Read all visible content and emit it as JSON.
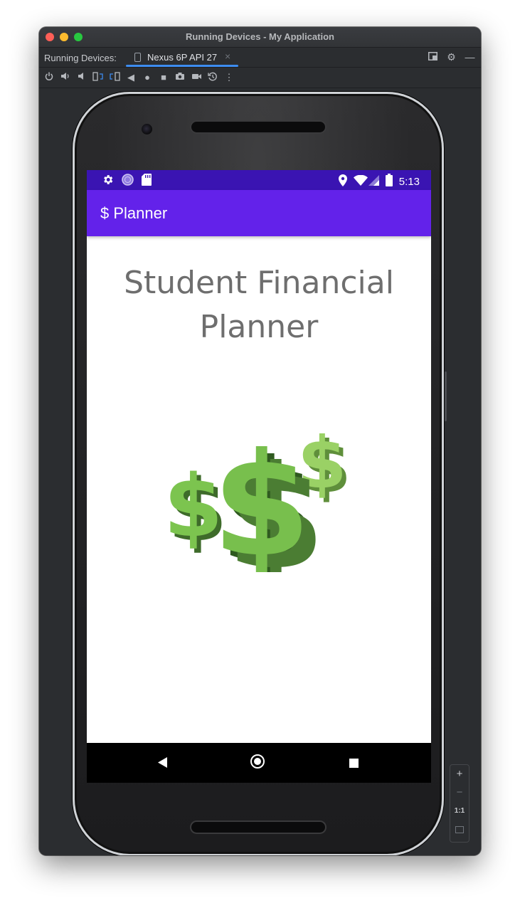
{
  "window": {
    "title": "Running Devices - My Application"
  },
  "tabbar": {
    "label": "Running Devices:",
    "tab_label": "Nexus 6P API 27",
    "close_glyph": "×"
  },
  "toolbar": {
    "icons": [
      "power-icon",
      "volume-up-icon",
      "volume-down-icon",
      "rotate-left-icon",
      "rotate-right-icon",
      "back-icon",
      "home-icon",
      "overview-icon",
      "screenshot-icon",
      "screen-record-icon",
      "snapshot-icon",
      "more-icon"
    ]
  },
  "device": {
    "status_time": "5:13",
    "app_title": "$ Planner",
    "content_title": "Student Financial Planner",
    "colors": {
      "status_bar": "#3a14b2",
      "app_bar": "#6322ea",
      "title_text": "#6e6e6e",
      "dollar_green": "#7cc44f"
    }
  },
  "zoom_controls": {
    "zoom_in": "+",
    "zoom_out": "−",
    "actual_size": "1:1"
  }
}
